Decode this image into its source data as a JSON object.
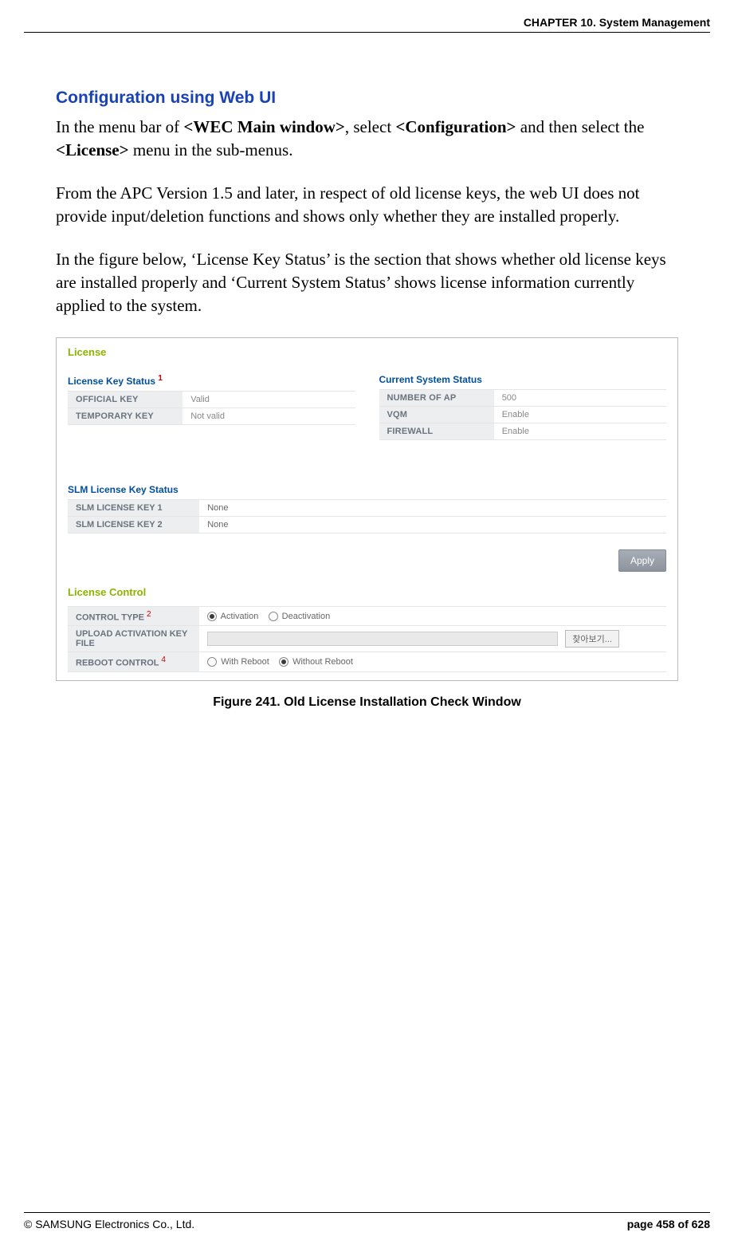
{
  "header": {
    "chapter": "CHAPTER 10. System Management"
  },
  "section": {
    "title": "Configuration using Web UI"
  },
  "paragraphs": {
    "p1_pre": "In the menu bar of ",
    "p1_bold1": "<WEC Main window>",
    "p1_mid": ", select ",
    "p1_bold2": "<Configuration>",
    "p1_mid2": " and then select the ",
    "p1_bold3": "<License>",
    "p1_post": " menu in the sub-menus.",
    "p2": "From the APC Version 1.5 and later, in respect of old license keys, the web UI does not provide input/deletion functions and shows only whether they are installed properly.",
    "p3": "In the figure below, ‘License Key Status’ is the section that shows whether old license keys are installed properly and ‘Current System Status’ shows license information currently applied to the system."
  },
  "figure": {
    "panel_title": "License",
    "license_key_status": {
      "title": "License Key Status",
      "sup": "1",
      "rows": [
        {
          "key": "OFFICIAL KEY",
          "val": "Valid"
        },
        {
          "key": "TEMPORARY KEY",
          "val": "Not valid"
        }
      ]
    },
    "current_system_status": {
      "title": "Current System Status",
      "rows": [
        {
          "key": "NUMBER OF AP",
          "val": "500"
        },
        {
          "key": "VQM",
          "val": "Enable"
        },
        {
          "key": "FIREWALL",
          "val": "Enable"
        }
      ]
    },
    "slm": {
      "title": "SLM License Key Status",
      "rows": [
        {
          "key": "SLM LICENSE KEY 1",
          "val": "None"
        },
        {
          "key": "SLM LICENSE KEY 2",
          "val": "None"
        }
      ]
    },
    "apply_label": "Apply",
    "license_control": {
      "title": "License Control",
      "control_type": {
        "label": "CONTROL TYPE",
        "sup": "2",
        "opt1": "Activation",
        "opt2": "Deactivation"
      },
      "upload": {
        "label": "UPLOAD ACTIVATION KEY FILE",
        "browse": "찾아보기..."
      },
      "reboot": {
        "label": "REBOOT CONTROL",
        "sup": "4",
        "opt1": "With Reboot",
        "opt2": "Without Reboot"
      }
    },
    "caption": "Figure 241. Old License Installation Check Window"
  },
  "footer": {
    "copyright": "© SAMSUNG Electronics Co., Ltd.",
    "page": "page 458 of 628"
  }
}
